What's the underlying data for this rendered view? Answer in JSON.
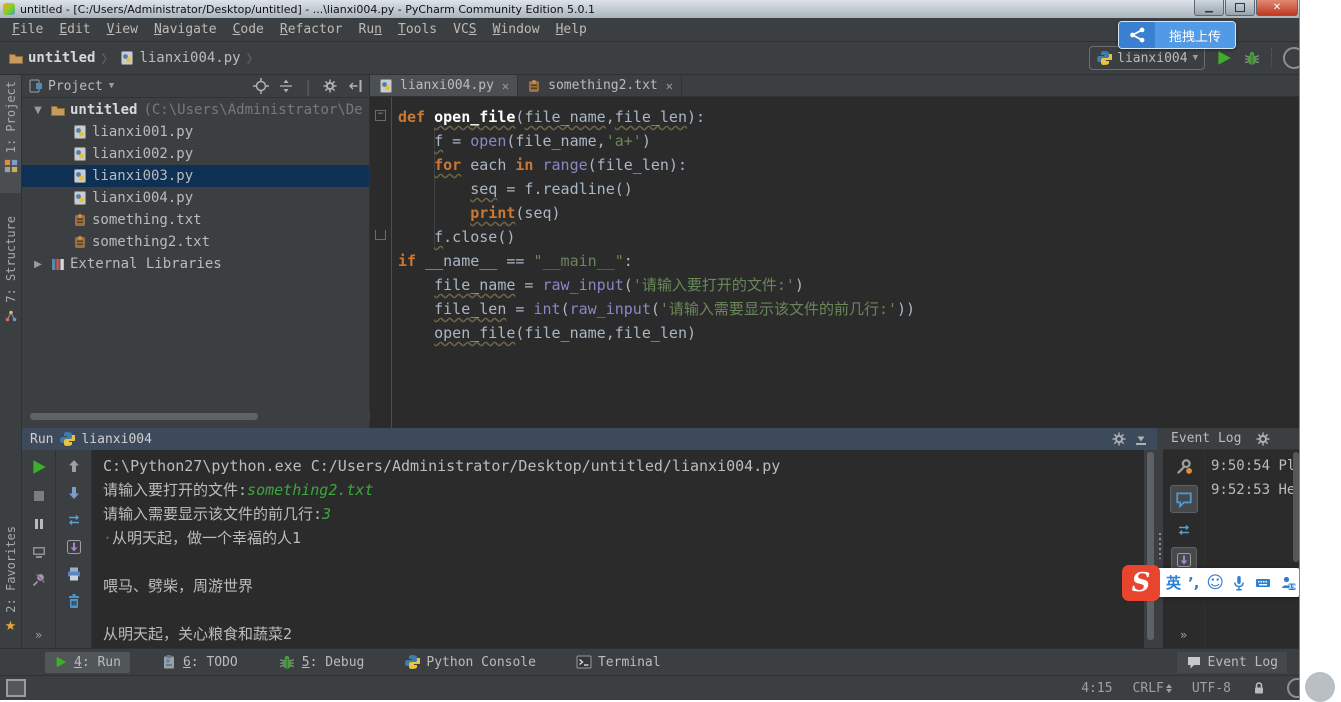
{
  "colors": {
    "kw": "#cc7832",
    "str": "#6a8759",
    "bi": "#8888c6",
    "cin": "#3fa53f",
    "accent_green": "#3fae2a",
    "upload_blue": "#529ae6",
    "sogou": "#e8442e",
    "selection": "#0d3054",
    "run_header": "#3d4a5c"
  },
  "window": {
    "title": "untitled - [C:/Users/Administrator/Desktop/untitled] - ...\\lianxi004.py - PyCharm Community Edition 5.0.1"
  },
  "menu": {
    "items": [
      {
        "label": "File",
        "key": 0
      },
      {
        "label": "Edit",
        "key": 0
      },
      {
        "label": "View",
        "key": 0
      },
      {
        "label": "Navigate",
        "key": 0
      },
      {
        "label": "Code",
        "key": 0
      },
      {
        "label": "Refactor",
        "key": 0
      },
      {
        "label": "Run",
        "key": 2
      },
      {
        "label": "Tools",
        "key": 0
      },
      {
        "label": "VCS",
        "key": 2
      },
      {
        "label": "Window",
        "key": 0
      },
      {
        "label": "Help",
        "key": 0
      }
    ]
  },
  "upload": {
    "label": "拖拽上传"
  },
  "breadcrumb": {
    "project": "untitled",
    "file": "lianxi004.py"
  },
  "toolbar": {
    "run_config": "lianxi004"
  },
  "stripe": {
    "project": "1: Project",
    "structure": "7: Structure",
    "favorites": "2: Favorites"
  },
  "project_panel": {
    "header": "Project",
    "root": {
      "name": "untitled",
      "path": "(C:\\Users\\Administrator\\De"
    },
    "files": [
      {
        "name": "lianxi001.py",
        "type": "py",
        "selected": false
      },
      {
        "name": "lianxi002.py",
        "type": "py",
        "selected": false
      },
      {
        "name": "lianxi003.py",
        "type": "py",
        "selected": true
      },
      {
        "name": "lianxi004.py",
        "type": "py",
        "selected": false
      },
      {
        "name": "something.txt",
        "type": "txt",
        "selected": false
      },
      {
        "name": "something2.txt",
        "type": "txt",
        "selected": false
      }
    ],
    "external": "External Libraries"
  },
  "tabs": [
    {
      "label": "lianxi004.py",
      "type": "py",
      "active": true
    },
    {
      "label": "something2.txt",
      "type": "txt",
      "active": false
    }
  ],
  "editor": {
    "lines": [
      [
        [
          "def ",
          "kw"
        ],
        [
          "open_file",
          "fn w"
        ],
        [
          "(",
          "pl"
        ],
        [
          "file_name",
          "pl w"
        ],
        [
          ",",
          "pl"
        ],
        [
          "file_len",
          "pl w"
        ],
        [
          "):",
          "pl"
        ]
      ],
      [
        [
          "    ",
          "pl"
        ],
        [
          "f",
          "pl w"
        ],
        [
          " = ",
          "pl"
        ],
        [
          "open",
          "bi"
        ],
        [
          "(file_name,",
          "pl"
        ],
        [
          "'a+'",
          "str"
        ],
        [
          ")",
          "pl"
        ]
      ],
      [
        [
          "    ",
          "pl"
        ],
        [
          "for",
          "kw w"
        ],
        [
          " each ",
          "pl"
        ],
        [
          "in",
          "kw"
        ],
        [
          " ",
          "pl"
        ],
        [
          "range",
          "bi"
        ],
        [
          "(file_len):",
          "pl"
        ]
      ],
      [
        [
          "        ",
          "pl"
        ],
        [
          "seq",
          "pl w"
        ],
        [
          " = f.readline()",
          "pl"
        ]
      ],
      [
        [
          "        ",
          "pl"
        ],
        [
          "print",
          "kw w"
        ],
        [
          "(seq)",
          "pl"
        ]
      ],
      [
        [
          "    ",
          "pl"
        ],
        [
          "f",
          "pl w"
        ],
        [
          ".close()",
          "pl"
        ]
      ],
      [
        [
          "if ",
          "kw"
        ],
        [
          "__name__ == ",
          "pl"
        ],
        [
          "\"__main__\"",
          "str"
        ],
        [
          ":",
          "pl"
        ]
      ],
      [
        [
          "    ",
          "pl"
        ],
        [
          "file_name",
          "pl w"
        ],
        [
          " = ",
          "pl"
        ],
        [
          "raw_input",
          "bi"
        ],
        [
          "(",
          "pl"
        ],
        [
          "'请输入要打开的文件:'",
          "str"
        ],
        [
          ")",
          "pl"
        ]
      ],
      [
        [
          "    ",
          "pl"
        ],
        [
          "file_len",
          "pl w"
        ],
        [
          " = ",
          "pl"
        ],
        [
          "int",
          "bi"
        ],
        [
          "(",
          "pl"
        ],
        [
          "raw_input",
          "bi"
        ],
        [
          "(",
          "pl"
        ],
        [
          "'请输入需要显示该文件的前几行:'",
          "str"
        ],
        [
          "))",
          "pl"
        ]
      ],
      [
        [
          "    ",
          "pl"
        ],
        [
          "open_file",
          "pl w"
        ],
        [
          "(file_name,file_len)",
          "pl"
        ]
      ]
    ]
  },
  "run_panel": {
    "title": "Run",
    "config": "lianxi004",
    "console_lines": [
      [
        [
          "C:\\Python27\\python.exe C:/Users/Administrator/Desktop/untitled/lianxi004.py",
          "out"
        ]
      ],
      [
        [
          "请输入要打开的文件:",
          "out"
        ],
        [
          "something2.txt",
          "in"
        ]
      ],
      [
        [
          "请输入需要显示该文件的前几行:",
          "out"
        ],
        [
          "3",
          "in"
        ]
      ],
      [
        [
          "·",
          "dim"
        ],
        [
          "从明天起，做一个幸福的人1",
          "out"
        ]
      ],
      [],
      [
        [
          "喂马、劈柴，周游世界",
          "out"
        ]
      ],
      [],
      [
        [
          "从明天起，关心粮食和蔬菜2",
          "out"
        ]
      ]
    ]
  },
  "event_log": {
    "title": "Event Log",
    "entries": [
      {
        "time": "9:50:54",
        "text": "Plat"
      },
      {
        "time": "9:52:53",
        "text": "Help"
      }
    ]
  },
  "bottom_bar": {
    "items": [
      {
        "label": "4: Run",
        "key": 0,
        "icon": "run",
        "active": true
      },
      {
        "label": "6: TODO",
        "key": 0,
        "icon": "todo",
        "active": false
      },
      {
        "label": "5: Debug",
        "key": 0,
        "icon": "debug",
        "active": false
      },
      {
        "label": "Python Console",
        "key": -1,
        "icon": "python",
        "active": false
      },
      {
        "label": "Terminal",
        "key": -1,
        "icon": "terminal",
        "active": false
      }
    ],
    "event_log_label": "Event Log"
  },
  "status_bar": {
    "caret": "4:15",
    "line_ending": "CRLF",
    "encoding": "UTF-8"
  },
  "ime": {
    "mode": "英",
    "punct": "’,"
  }
}
